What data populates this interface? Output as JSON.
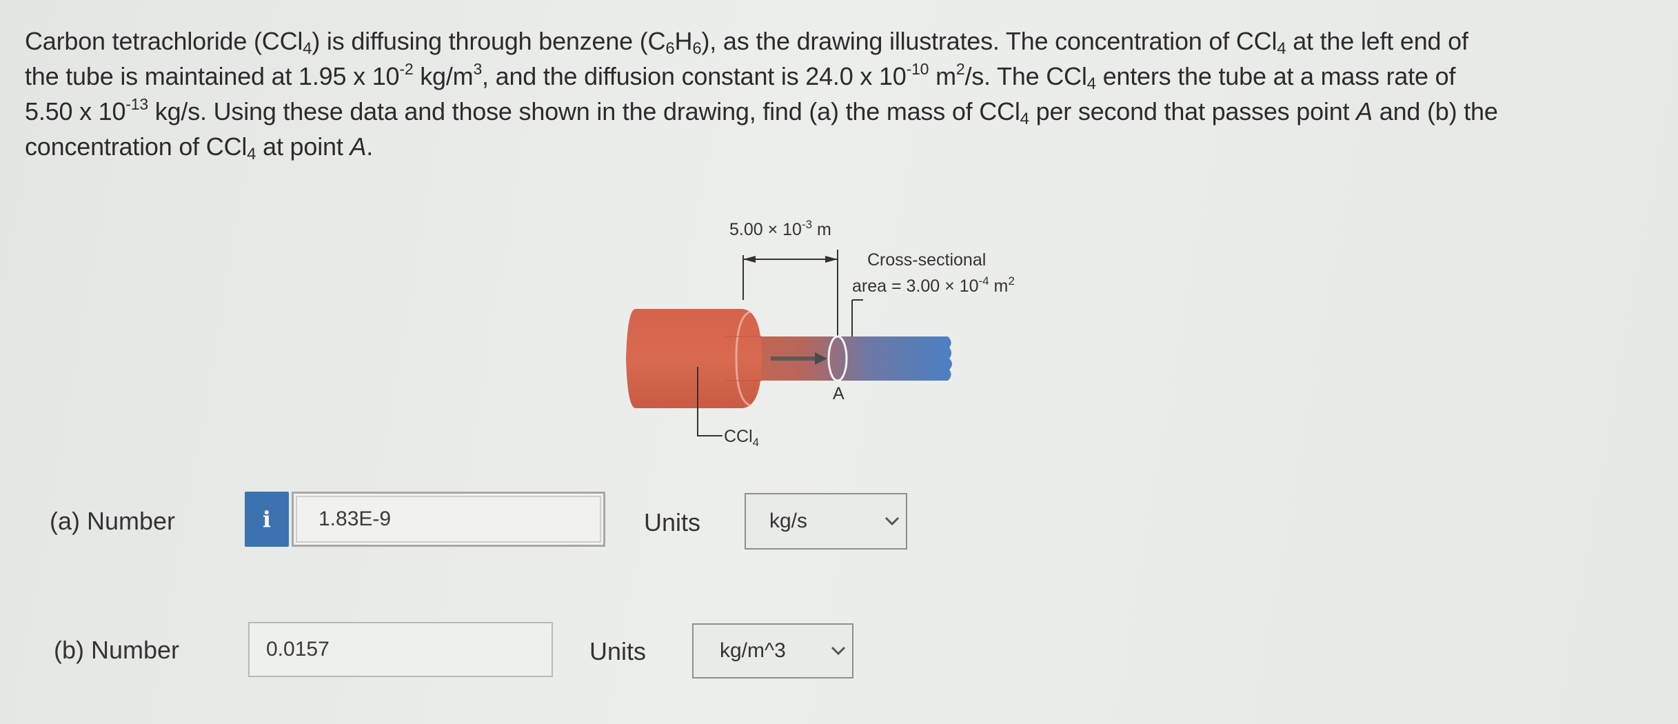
{
  "problem": {
    "segments": [
      "Carbon tetrachloride (CCl",
      "4",
      ") is diffusing through benzene (C",
      "6",
      "H",
      "6",
      "), as the drawing illustrates. The concentration of CCl",
      "4",
      " at the left end of",
      "the tube is maintained at 1.95 x 10",
      "-2",
      " kg/m",
      "3",
      ", and the diffusion constant is 24.0 x 10",
      "-10",
      " m",
      "2",
      "/s. The CCl",
      "4",
      " enters the tube at a mass rate of",
      "5.50 x 10",
      "-13",
      " kg/s. Using these data and those shown in the drawing, find (a) the mass of CCl",
      "4",
      " per second that passes point ",
      "A",
      " and (b) the",
      "concentration of CCl",
      "4",
      " at point ",
      "A",
      "."
    ]
  },
  "figure": {
    "length_label": "5.00 × 10",
    "length_exp": "-3",
    "length_unit": " m",
    "area_line1": "Cross-sectional",
    "area_line2": "area = 3.00 × 10",
    "area_exp": "-4",
    "area_unit": " m",
    "area_unit_exp": "2",
    "point_label": "A",
    "ccl4_label": "CCl",
    "ccl4_sub": "4",
    "colors": {
      "reservoir": "#d4634a",
      "tube_start": "#c9664c",
      "tube_end": "#4d7fc1"
    }
  },
  "part_a": {
    "label": "(a)   Number",
    "info_icon": "i",
    "value": "1.83E-9",
    "units_label": "Units",
    "units_value": "kg/s"
  },
  "part_b": {
    "label": "(b)   Number",
    "value": "0.0157",
    "units_label": "Units",
    "units_value": "kg/m^3"
  }
}
